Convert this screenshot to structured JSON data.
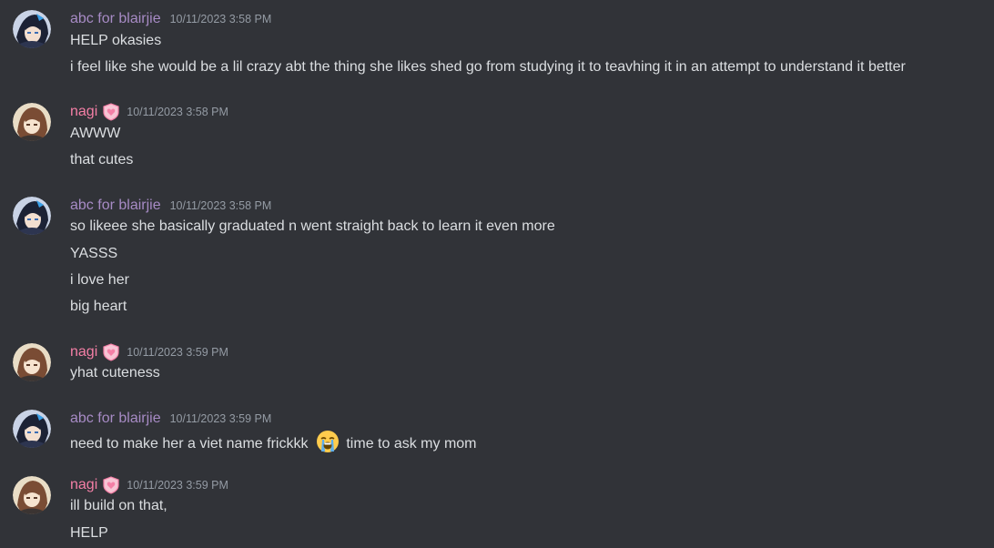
{
  "colors": {
    "background": "#313338",
    "text": "#dbdee1",
    "timestamp": "#949ba4",
    "user_abc": "#a78bc5",
    "user_nagi": "#f47fa6"
  },
  "messages": [
    {
      "author": "abc for blairjie",
      "timestamp": "10/11/2023 3:58 PM",
      "lines": [
        "HELP okasies",
        "i feel like she would be a lil crazy abt the thing she likes shed go from studying it to teavhing it in an attempt to understand it better"
      ]
    },
    {
      "author": "nagi",
      "role_icon": "shield-heart-icon",
      "timestamp": "10/11/2023 3:58 PM",
      "lines": [
        "AWWW",
        "that cutes"
      ]
    },
    {
      "author": "abc for blairjie",
      "timestamp": "10/11/2023 3:58 PM",
      "lines": [
        "so likeee she basically graduated n went straight back to learn it even more",
        "YASSS",
        "i love her",
        "big heart"
      ]
    },
    {
      "author": "nagi",
      "role_icon": "shield-heart-icon",
      "timestamp": "10/11/2023 3:59 PM",
      "lines": [
        "yhat cuteness"
      ]
    },
    {
      "author": "abc for blairjie",
      "timestamp": "10/11/2023 3:59 PM",
      "lines": [
        {
          "before": "need to make her a viet name frickkk",
          "emoji": "loudly-crying-face-emoji",
          "after": "time to ask my mom"
        }
      ]
    },
    {
      "author": "nagi",
      "role_icon": "shield-heart-icon",
      "timestamp": "10/11/2023 3:59 PM",
      "lines": [
        "ill build on that,",
        "HELP"
      ]
    }
  ]
}
